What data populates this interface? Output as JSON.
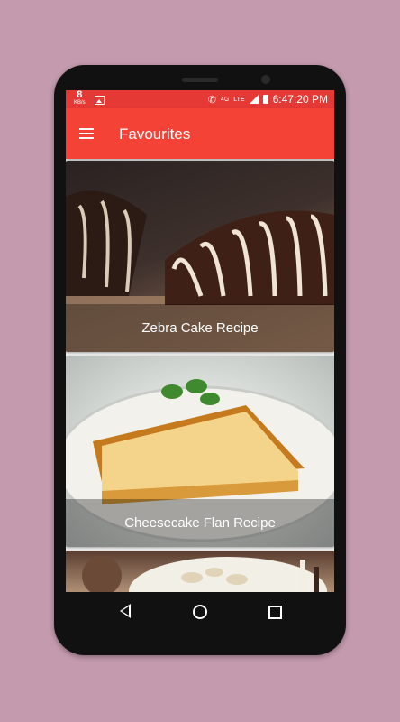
{
  "status_bar": {
    "speed_value": "8",
    "speed_unit": "KB/s",
    "network_4g": "4G",
    "network_lte": "LTE",
    "battery_level": "22",
    "time": "6:47:20 PM"
  },
  "app_bar": {
    "title": "Favourites"
  },
  "recipes": [
    {
      "label": "Zebra Cake Recipe"
    },
    {
      "label": "Cheesecake Flan Recipe"
    },
    {
      "label": ""
    }
  ],
  "colors": {
    "status_bar": "#e53935",
    "app_bar": "#f44336",
    "background": "#c49aae"
  }
}
